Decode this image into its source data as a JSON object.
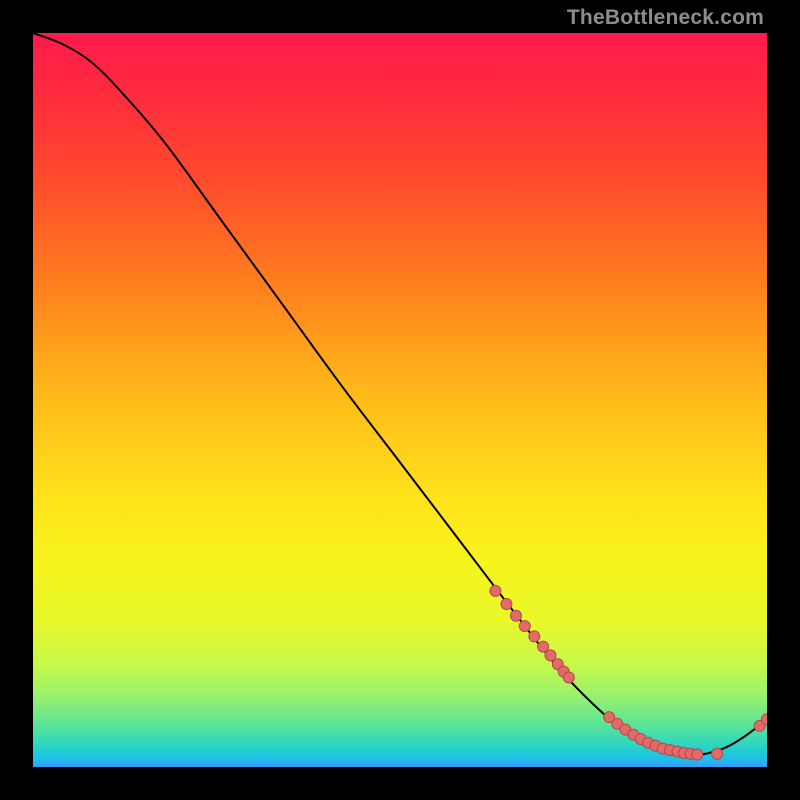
{
  "watermark": "TheBottleneck.com",
  "colors": {
    "curve": "#000000",
    "marker_fill": "#e46a6a",
    "marker_stroke": "#b24a4a"
  },
  "chart_data": {
    "type": "line",
    "title": "",
    "xlabel": "",
    "ylabel": "",
    "xlim": [
      0,
      100
    ],
    "ylim": [
      0,
      100
    ],
    "grid": false,
    "curve": {
      "x": [
        0,
        4,
        8,
        12,
        18,
        26,
        34,
        42,
        50,
        58,
        66,
        72,
        78,
        82,
        86,
        90,
        94,
        97,
        100
      ],
      "y": [
        100,
        98.5,
        96,
        92,
        85,
        74,
        63,
        52,
        41.5,
        31,
        20.5,
        13,
        7,
        4,
        2.2,
        1.6,
        2.5,
        4.2,
        6.5
      ]
    },
    "markers": {
      "x": [
        63,
        64.5,
        65.8,
        67,
        68.3,
        69.5,
        70.5,
        71.5,
        72.3,
        73,
        78.5,
        79.6,
        80.7,
        81.8,
        82.8,
        83.8,
        84.8,
        85.8,
        86.8,
        87.8,
        88.7,
        89.6,
        90.5,
        93.2,
        99.0,
        100.0
      ],
      "y": [
        24.0,
        22.2,
        20.6,
        19.2,
        17.8,
        16.4,
        15.2,
        14.0,
        13.0,
        12.2,
        6.8,
        5.9,
        5.1,
        4.4,
        3.8,
        3.3,
        2.9,
        2.5,
        2.3,
        2.1,
        1.9,
        1.8,
        1.7,
        1.8,
        5.6,
        6.5
      ]
    }
  }
}
